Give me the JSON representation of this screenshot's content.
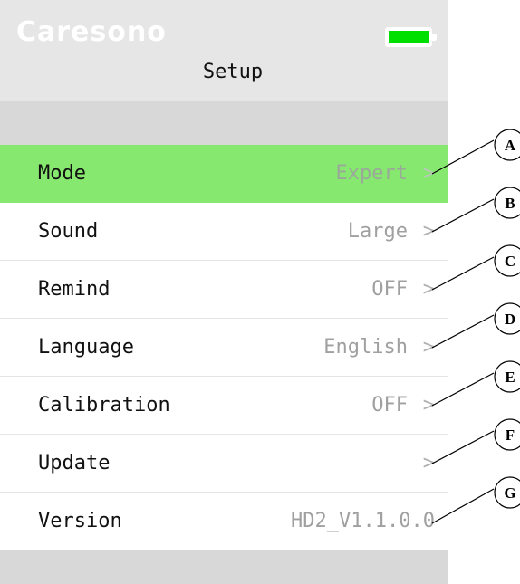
{
  "header": {
    "brand": "Caresono",
    "title": "Setup",
    "battery_level": 1.0
  },
  "menu": [
    {
      "label": "Mode",
      "value": "Expert",
      "chevron": ">",
      "selected": true
    },
    {
      "label": "Sound",
      "value": "Large",
      "chevron": ">"
    },
    {
      "label": "Remind",
      "value": "OFF",
      "chevron": ">"
    },
    {
      "label": "Language",
      "value": "English",
      "chevron": ">"
    },
    {
      "label": "Calibration",
      "value": "OFF",
      "chevron": ">"
    },
    {
      "label": "Update",
      "value": "",
      "chevron": ">"
    },
    {
      "label": "Version",
      "value": "HD2_V1.1.0.0"
    }
  ],
  "callouts": [
    "A",
    "B",
    "C",
    "D",
    "E",
    "F",
    "G"
  ],
  "colors": {
    "header_bg": "#e6e6e6",
    "selected_bg": "#86e86e",
    "battery": "#00e000",
    "band": "#d8d8d8"
  }
}
